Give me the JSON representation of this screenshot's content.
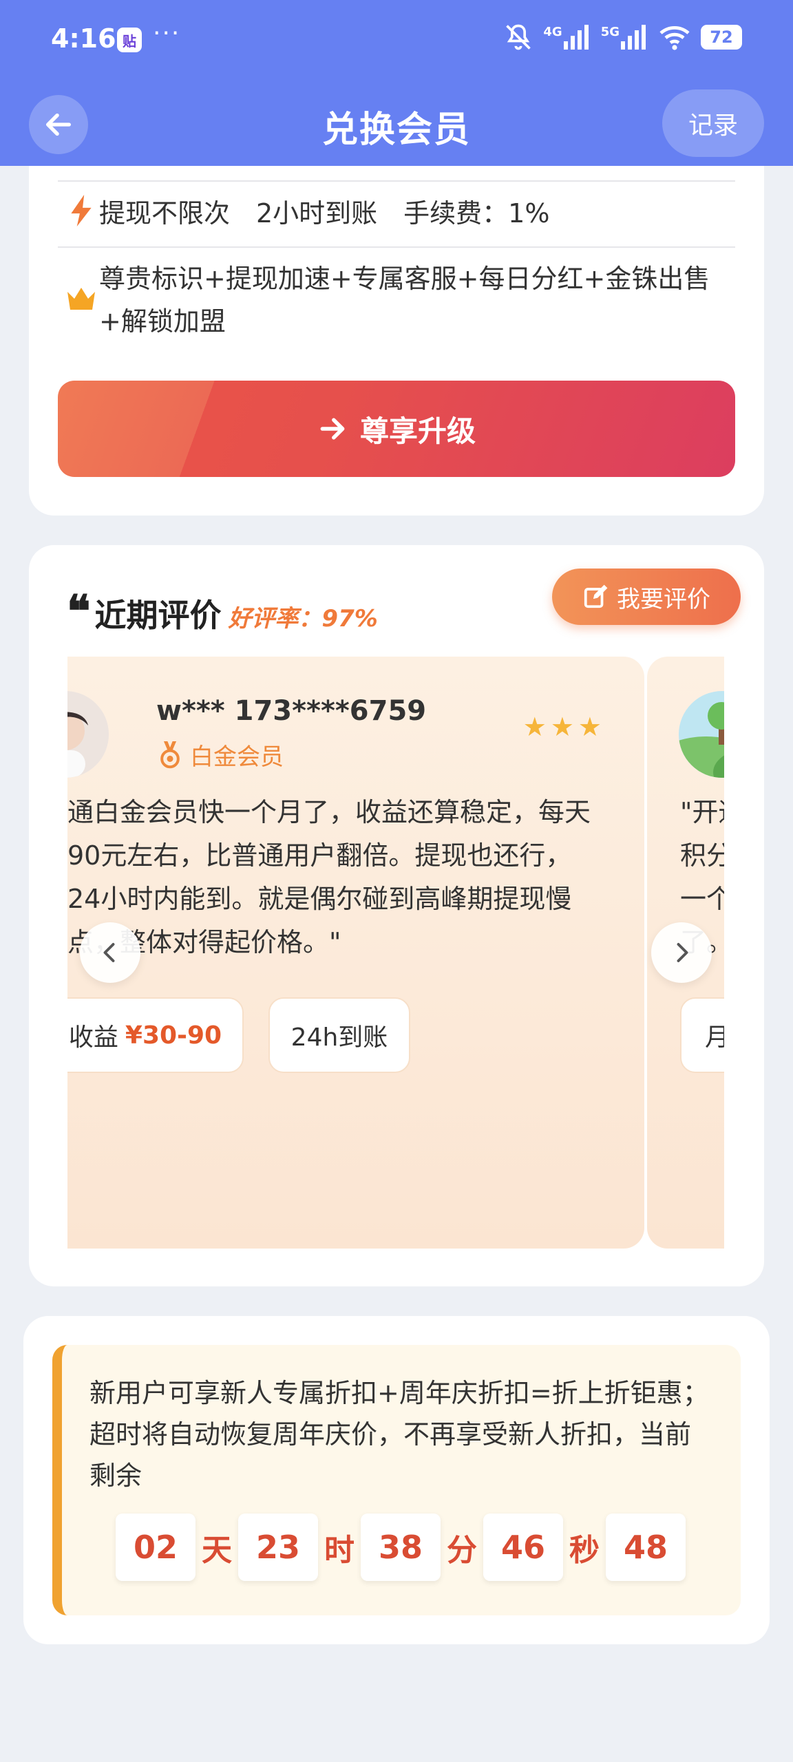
{
  "status_bar": {
    "time": "4:16",
    "app_icon_text": "贴",
    "dots": "···",
    "net_1": "4G",
    "net_2": "5G",
    "battery": "72"
  },
  "navbar": {
    "title": "兑换会员",
    "record_label": "记录"
  },
  "membership_card": {
    "feature_1": "提现不限次　2小时到账　手续费：1%",
    "feature_2": "尊贵标识+提现加速+专属客服+每日分红+金铢出售+解锁加盟",
    "upgrade_label": "尊享升级"
  },
  "reviews": {
    "quote_mark": "❝",
    "title": "近期评价",
    "good_rate": "好评率：97%",
    "write_review_label": "我要评价",
    "items": [
      {
        "name": "w*** 173****6759",
        "badge": "白金会员",
        "stars": "★★★",
        "text_lines": [
          "通白金会员快一个月了，收益还算稳定，每天",
          "90元左右，比普通用户翻倍。提现也还行，",
          "24小时内能到。就是偶尔碰到高峰期提现慢",
          "点，整体对得起价格。\""
        ],
        "tag_1_label": "收益",
        "tag_1_value": "¥30-90",
        "tag_2": "24h到账"
      },
      {
        "text_lines": [
          "\"开通",
          "积分",
          "一个",
          "了。"
        ],
        "tag_1": "月"
      }
    ]
  },
  "notice": {
    "text": "新用户可享新人专属折扣+周年庆折扣=折上折钜惠；超时将自动恢复周年庆价，不再享受新人折扣，当前剩余",
    "countdown": {
      "days": "02",
      "days_unit": "天",
      "hours": "23",
      "hours_unit": "时",
      "minutes": "38",
      "minutes_unit": "分",
      "seconds": "46",
      "seconds_unit": "秒",
      "ms": "48"
    }
  },
  "colors": {
    "header": "#6680f2",
    "accent_orange": "#f07a3a",
    "countdown_red": "#d94c33",
    "notice_border": "#f0a230"
  }
}
